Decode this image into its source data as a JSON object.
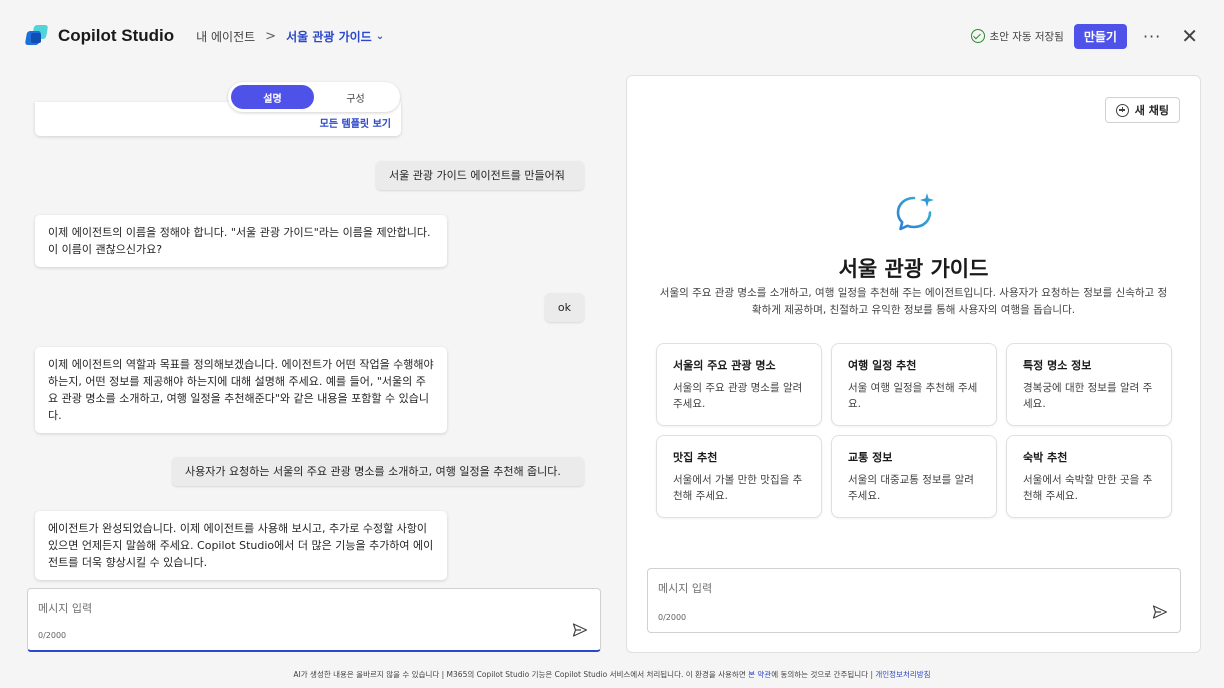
{
  "header": {
    "app_title": "Copilot Studio",
    "breadcrumb_root": "내 에이전트",
    "breadcrumb_sep": ">",
    "breadcrumb_current": "서울 관광 가이드",
    "save_status": "초안 자동 저장됨",
    "create_label": "만들기",
    "more_label": "···",
    "close_label": "✕"
  },
  "left": {
    "tabs": [
      {
        "label": "설명",
        "active": true
      },
      {
        "label": "구성",
        "active": false
      }
    ],
    "cut_link": "모든 템플릿 보기",
    "messages": [
      {
        "role": "user",
        "text": "서울 관광 가이드 에이전트를 만들어줘"
      },
      {
        "role": "bot",
        "text": "이제 에이전트의 이름을 정해야 합니다. \"서울 관광 가이드\"라는 이름을 제안합니다. 이 이름이 괜찮으신가요?"
      },
      {
        "role": "user",
        "text": "ok"
      },
      {
        "role": "bot",
        "text": "이제 에이전트의 역할과 목표를 정의해보겠습니다. 에이전트가 어떤 작업을 수행해야 하는지, 어떤 정보를 제공해야 하는지에 대해 설명해 주세요. 예를 들어, \"서울의 주요 관광 명소를 소개하고, 여행 일정을 추천해준다\"와 같은 내용을 포함할 수 있습니다."
      },
      {
        "role": "user",
        "text": "사용자가 요청하는 서울의 주요 관광 명소를 소개하고, 여행 일정을 추천해 줍니다."
      },
      {
        "role": "bot",
        "text": "에이전트가 완성되었습니다. 이제 에이전트를 사용해 보시고, 추가로 수정할 사항이 있으면 언제든지 말씀해 주세요. Copilot Studio에서 더 많은 기능을 추가하여 에이전트를 더욱 향상시킬 수 있습니다."
      }
    ],
    "composer": {
      "placeholder": "메시지 입력",
      "counter": "0/2000"
    }
  },
  "right": {
    "new_chat_label": "새 채팅",
    "agent_title": "서울 관광 가이드",
    "agent_description": "서울의 주요 관광 명소를 소개하고, 여행 일정을 추천해 주는 에이전트입니다. 사용자가 요청하는 정보를 신속하고 정확하게 제공하며, 친절하고 유익한 정보를 통해 사용자의 여행을 돕습니다.",
    "cards": [
      {
        "title": "서울의 주요 관광 명소",
        "body": "서울의 주요 관광 명소를 알려주세요."
      },
      {
        "title": "여행 일정 추천",
        "body": "서울 여행 일정을 추천해 주세요."
      },
      {
        "title": "특정 명소 정보",
        "body": "경복궁에 대한 정보를 알려 주세요."
      },
      {
        "title": "맛집 추천",
        "body": "서울에서 가볼 만한 맛집을 추천해 주세요."
      },
      {
        "title": "교통 정보",
        "body": "서울의 대중교통 정보를 알려주세요."
      },
      {
        "title": "숙박 추천",
        "body": "서울에서 숙박할 만한 곳을 추천해 주세요."
      }
    ],
    "composer": {
      "placeholder": "메시지 입력",
      "counter": "0/2000"
    }
  },
  "footer": {
    "text": "AI가 생성한 내용은 올바르지 않을 수 있습니다 | M365의 Copilot Studio 기능은 Copilot Studio 서비스에서 처리됩니다. 이 환경을 사용하면",
    "terms_link": "본 약관",
    "text2": "에 동의하는 것으로 간주됩니다 |",
    "privacy_link": "개인정보처리방침"
  },
  "colors": {
    "accent": "#4f52e8",
    "link": "#2b48c9",
    "success": "#2e8b32"
  }
}
